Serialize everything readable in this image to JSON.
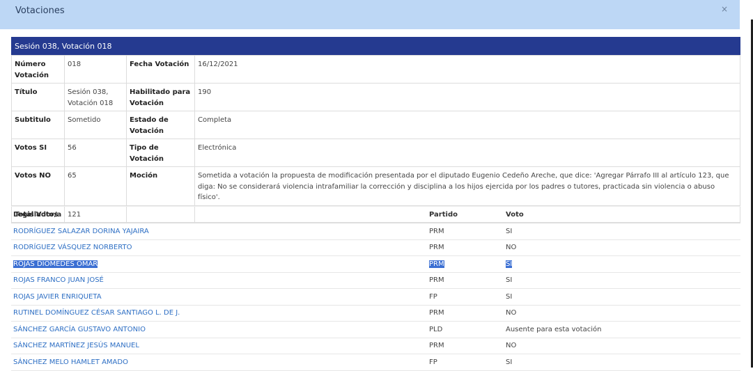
{
  "modal": {
    "title": "Votaciones",
    "close_label": "×"
  },
  "section": {
    "title": "Sesión 038, Votación 018"
  },
  "details": {
    "numero_label": "Número Votación",
    "numero_value": "018",
    "fecha_label": "Fecha Votación",
    "fecha_value": "16/12/2021",
    "titulo_label": "Título",
    "titulo_value": "Sesión 038, Votación 018",
    "habilitado_label": "Habilitado para Votación",
    "habilitado_value": "190",
    "subtitulo_label": "Subtitulo",
    "subtitulo_value": "Sometido",
    "estado_label": "Estado de Votación",
    "estado_value": "Completa",
    "votos_si_label": "Votos SI",
    "votos_si_value": "56",
    "tipo_label": "Tipo de Votación",
    "tipo_value": "Electrónica",
    "votos_no_label": "Votos NO",
    "votos_no_value": "65",
    "mocion_label": "Moción",
    "mocion_value": "Sometida a votación la propuesta de modificación presentada por el diputado Eugenio Cedeño Areche, que dice: 'Agregar Párrafo III al artículo 123, que diga: No se considerará violencia intrafamiliar la corrección y disciplina a los hijos ejercida por los padres o tutores, practicada sin violencia o abuso físico'.",
    "total_label": "Total Votos",
    "total_value": "121"
  },
  "votes": {
    "headers": {
      "legislador": "Legislador/a",
      "partido": "Partido",
      "voto": "Voto"
    },
    "rows": [
      {
        "name": "RODRÍGUEZ SALAZAR DORINA YAJAIRA",
        "party": "PRM",
        "vote": "SI"
      },
      {
        "name": "RODRÍGUEZ VÁSQUEZ NORBERTO",
        "party": "PRM",
        "vote": "NO"
      },
      {
        "name": "ROJAS DIÓMEDES OMAR",
        "party": "PRM",
        "vote": "SI"
      },
      {
        "name": "ROJAS FRANCO JUAN JOSÉ",
        "party": "PRM",
        "vote": "SI"
      },
      {
        "name": "ROJAS JAVIER ENRIQUETA",
        "party": "FP",
        "vote": "SI"
      },
      {
        "name": "RUTINEL DOMÍNGUEZ CÉSAR SANTIAGO L. DE J.",
        "party": "PRM",
        "vote": "NO"
      },
      {
        "name": "SÁNCHEZ GARCÍA GUSTAVO ANTONIO",
        "party": "PLD",
        "vote": "Ausente para esta votación"
      },
      {
        "name": "SÁNCHEZ MARTÍNEZ JESÚS MANUEL",
        "party": "PRM",
        "vote": "NO"
      },
      {
        "name": "SÁNCHEZ MELO HAMLET AMADO",
        "party": "FP",
        "vote": "SI"
      }
    ]
  },
  "colors": {
    "header_bg": "#bdd7f5",
    "section_bar": "#253a90",
    "link": "#2e6fc4",
    "selection": "#3b6fd3"
  }
}
